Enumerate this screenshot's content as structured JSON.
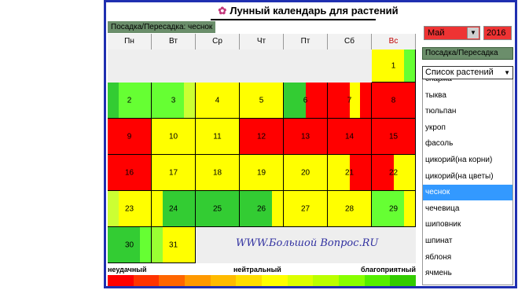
{
  "title": "Лунный календарь для растений",
  "mode_label": "Посадка/Пересадка: чеснок",
  "weekdays": [
    "Пн",
    "Вт",
    "Ср",
    "Чт",
    "Пт",
    "Сб",
    "Вс"
  ],
  "month_select": "Май",
  "year_select": "2016",
  "mode_button": "Посадка/Пересадка",
  "plant_list_title": "Список растений",
  "plants": [
    "спаржа",
    "тыква",
    "тюльпан",
    "укроп",
    "фасоль",
    "цикорий(на корни)",
    "цикорий(на цветы)",
    "чеснок",
    "чечевица",
    "шиповник",
    "шпинат",
    "яблоня",
    "ячмень"
  ],
  "selected_plant": "чеснок",
  "days": [
    {
      "d": "1",
      "row": 0,
      "col": 6,
      "colors": [
        "#ffff00",
        "#ffff00",
        "#ffff00",
        "#66ff33"
      ]
    },
    {
      "d": "2",
      "row": 1,
      "col": 0,
      "colors": [
        "#33cc33",
        "#66ff33",
        "#66ff33",
        "#66ff33"
      ]
    },
    {
      "d": "3",
      "row": 1,
      "col": 1,
      "colors": [
        "#66ff33",
        "#66ff33",
        "#66ff33",
        "#ccff33"
      ]
    },
    {
      "d": "4",
      "row": 1,
      "col": 2,
      "colors": [
        "#ffff00",
        "#ffff00",
        "#ffff00",
        "#ffff00"
      ]
    },
    {
      "d": "5",
      "row": 1,
      "col": 3,
      "colors": [
        "#ffff00",
        "#ffff00",
        "#ffff00",
        "#ffff00"
      ]
    },
    {
      "d": "6",
      "row": 1,
      "col": 4,
      "colors": [
        "#33cc33",
        "#33cc33",
        "#ff0000",
        "#ff0000"
      ]
    },
    {
      "d": "7",
      "row": 1,
      "col": 5,
      "colors": [
        "#ff0000",
        "#ff0000",
        "#ffff00",
        "#ff0000"
      ]
    },
    {
      "d": "8",
      "row": 1,
      "col": 6,
      "colors": [
        "#ff0000",
        "#ff0000",
        "#ff0000",
        "#ff0000"
      ]
    },
    {
      "d": "9",
      "row": 2,
      "col": 0,
      "colors": [
        "#ff0000",
        "#ff0000",
        "#ff0000",
        "#ff0000"
      ]
    },
    {
      "d": "10",
      "row": 2,
      "col": 1,
      "colors": [
        "#ffff00",
        "#ffff00",
        "#ffff00",
        "#ffff00"
      ]
    },
    {
      "d": "11",
      "row": 2,
      "col": 2,
      "colors": [
        "#ffff00",
        "#ffff00",
        "#ffff00",
        "#ffff00"
      ]
    },
    {
      "d": "12",
      "row": 2,
      "col": 3,
      "colors": [
        "#ff0000",
        "#ff0000",
        "#ff0000",
        "#ff0000"
      ]
    },
    {
      "d": "13",
      "row": 2,
      "col": 4,
      "colors": [
        "#ff0000",
        "#ff0000",
        "#ff0000",
        "#ff0000"
      ]
    },
    {
      "d": "14",
      "row": 2,
      "col": 5,
      "colors": [
        "#ff0000",
        "#ff0000",
        "#ff0000",
        "#ff0000"
      ]
    },
    {
      "d": "15",
      "row": 2,
      "col": 6,
      "colors": [
        "#ff0000",
        "#ff0000",
        "#ff0000",
        "#ff0000"
      ]
    },
    {
      "d": "16",
      "row": 3,
      "col": 0,
      "colors": [
        "#ff0000",
        "#ff0000",
        "#ff0000",
        "#ff0000"
      ]
    },
    {
      "d": "17",
      "row": 3,
      "col": 1,
      "colors": [
        "#ffff00",
        "#ffff00",
        "#ffff00",
        "#ffff00"
      ]
    },
    {
      "d": "18",
      "row": 3,
      "col": 2,
      "colors": [
        "#ffff00",
        "#ffff00",
        "#ffff00",
        "#ffff00"
      ]
    },
    {
      "d": "19",
      "row": 3,
      "col": 3,
      "colors": [
        "#ffff00",
        "#ffff00",
        "#ffff00",
        "#ffff00"
      ]
    },
    {
      "d": "20",
      "row": 3,
      "col": 4,
      "colors": [
        "#ffff00",
        "#ffff00",
        "#ffff00",
        "#ffff00"
      ]
    },
    {
      "d": "21",
      "row": 3,
      "col": 5,
      "colors": [
        "#ffff00",
        "#ffff00",
        "#ff0000",
        "#ff0000"
      ]
    },
    {
      "d": "22",
      "row": 3,
      "col": 6,
      "colors": [
        "#ff0000",
        "#ff0000",
        "#ffff00",
        "#ffff00"
      ]
    },
    {
      "d": "23",
      "row": 4,
      "col": 0,
      "colors": [
        "#ccff33",
        "#ffff00",
        "#ffff00",
        "#ffff00"
      ]
    },
    {
      "d": "24",
      "row": 4,
      "col": 1,
      "colors": [
        "#ffff00",
        "#33cc33",
        "#33cc33",
        "#33cc33"
      ]
    },
    {
      "d": "25",
      "row": 4,
      "col": 2,
      "colors": [
        "#33cc33",
        "#33cc33",
        "#33cc33",
        "#33cc33"
      ]
    },
    {
      "d": "26",
      "row": 4,
      "col": 3,
      "colors": [
        "#33cc33",
        "#33cc33",
        "#33cc33",
        "#ffff00"
      ]
    },
    {
      "d": "27",
      "row": 4,
      "col": 4,
      "colors": [
        "#ffff00",
        "#ffff00",
        "#ffff00",
        "#ffff00"
      ]
    },
    {
      "d": "28",
      "row": 4,
      "col": 5,
      "colors": [
        "#ffff00",
        "#ffff00",
        "#ffff00",
        "#ffff00"
      ]
    },
    {
      "d": "29",
      "row": 4,
      "col": 6,
      "colors": [
        "#66ff33",
        "#66ff33",
        "#66ff33",
        "#ffff00"
      ]
    },
    {
      "d": "30",
      "row": 5,
      "col": 0,
      "colors": [
        "#33cc33",
        "#33cc33",
        "#33cc33",
        "#66ff33"
      ]
    },
    {
      "d": "31",
      "row": 5,
      "col": 1,
      "colors": [
        "#99ff33",
        "#ffff00",
        "#ffff00",
        "#ffff00"
      ]
    }
  ],
  "watermark": "WWW.Большой Вопрос.RU",
  "legend": {
    "bad": "неудачный",
    "neutral": "нейтральный",
    "good": "благоприятный",
    "colors": [
      "#ff0000",
      "#ff3300",
      "#ff6600",
      "#ff9900",
      "#ffbb00",
      "#ffdd00",
      "#ffff00",
      "#ddff00",
      "#bbff00",
      "#88ff00",
      "#55ee00",
      "#33cc00"
    ]
  }
}
